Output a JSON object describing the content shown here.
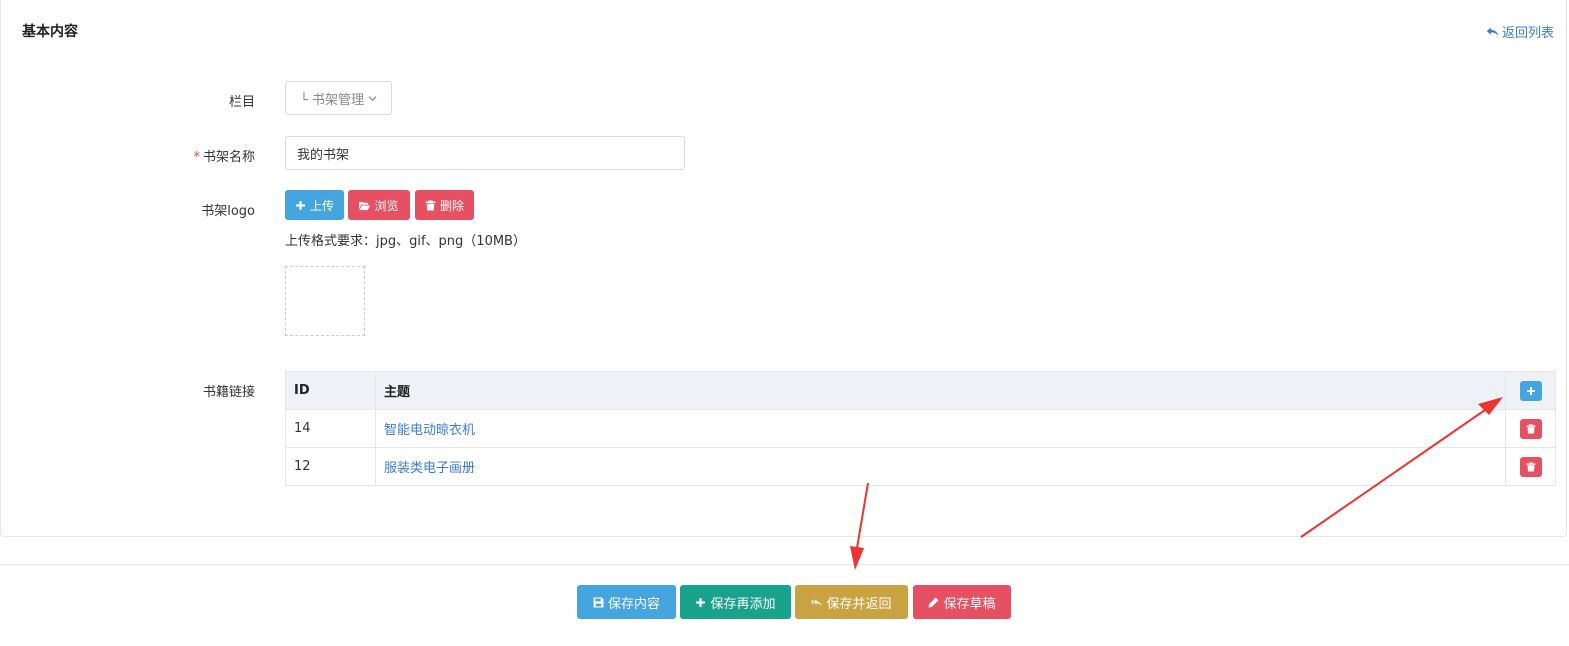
{
  "panel": {
    "title": "基本内容",
    "back_link": "返回列表"
  },
  "form": {
    "category": {
      "label": "栏目",
      "value": "└ 书架管理"
    },
    "name": {
      "label": "书架名称",
      "required_mark": "*",
      "value": "我的书架"
    },
    "logo": {
      "label": "书架logo",
      "upload_label": "上传",
      "browse_label": "浏览",
      "delete_label": "删除",
      "hint": "上传格式要求：jpg、gif、png（10MB）"
    },
    "links": {
      "label": "书籍链接",
      "columns": [
        "ID",
        "主题"
      ],
      "rows": [
        {
          "id": "14",
          "topic": "智能电动晾衣机"
        },
        {
          "id": "12",
          "topic": "服装类电子画册"
        }
      ]
    }
  },
  "actions": {
    "save_content": "保存内容",
    "save_add": "保存再添加",
    "save_return": "保存并返回",
    "save_draft": "保存草稿"
  },
  "colors": {
    "primary": "#45a5de",
    "danger": "#e65063",
    "success": "#1aa38c",
    "warning": "#c9a342",
    "link": "#3a7bd5",
    "annotation_arrow": "#ee3333"
  }
}
